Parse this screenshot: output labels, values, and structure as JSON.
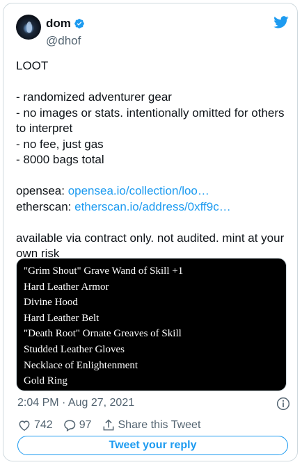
{
  "author": {
    "display_name": "dom",
    "handle": "@dhof",
    "verified": true
  },
  "icons": {
    "brand": "twitter-bird-icon",
    "verified": "verified-badge-icon",
    "info": "info-icon",
    "like": "heart-icon",
    "reply": "reply-icon",
    "share": "share-icon"
  },
  "colors": {
    "accent": "#1d9bf0",
    "text": "#0f1419",
    "secondary": "#536471",
    "media_bg": "#000000"
  },
  "tweet": {
    "title": "LOOT",
    "bullets": [
      "- randomized adventurer gear",
      "- no images or stats. intentionally omitted for others to interpret",
      "- no fee, just gas",
      "- 8000 bags total"
    ],
    "opensea_label": "opensea:",
    "opensea_link": "opensea.io/collection/loo…",
    "etherscan_label": "etherscan:",
    "etherscan_link": "etherscan.io/address/0xff9c…",
    "footer": "available via contract only. not audited. mint at your own risk"
  },
  "media": {
    "items": [
      "\"Grim Shout\" Grave Wand of Skill +1",
      "Hard Leather Armor",
      "Divine Hood",
      "Hard Leather Belt",
      "\"Death Root\" Ornate Greaves of Skill",
      "Studded Leather Gloves",
      "Necklace of Enlightenment",
      "Gold Ring"
    ]
  },
  "meta": {
    "timestamp": "2:04 PM · Aug 27, 2021"
  },
  "actions": {
    "likes": "742",
    "replies": "97",
    "share_label": "Share this Tweet"
  },
  "reply_button": {
    "label": "Tweet your reply"
  }
}
